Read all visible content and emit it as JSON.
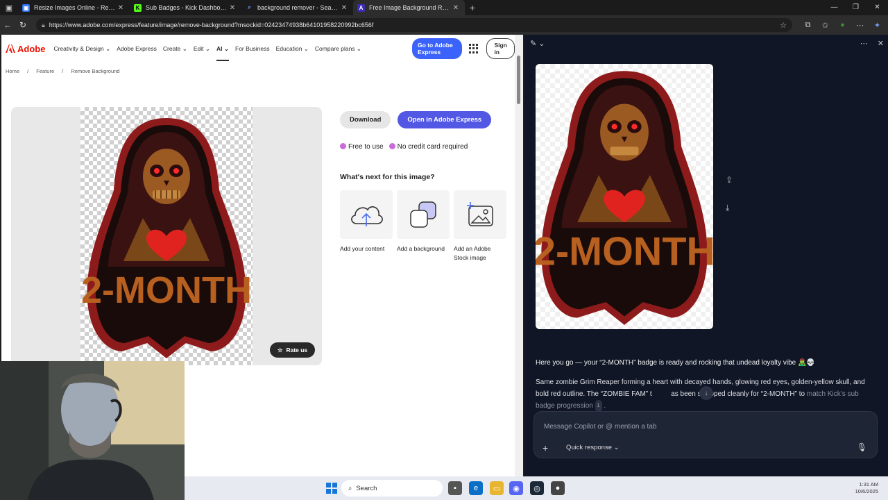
{
  "browser": {
    "tabs": [
      {
        "title": "Resize Images Online - Resize JPG",
        "icon_color": "#2a6ff0",
        "icon": "image-icon"
      },
      {
        "title": "Sub Badges - Kick Dashboard",
        "icon_color": "#53fc18",
        "icon": "kick-icon",
        "icon_glyph": "K"
      },
      {
        "title": "background remover - Search",
        "icon_color": "#2b6ddb",
        "icon": "search-icon"
      },
      {
        "title": "Free Image Background Remover",
        "icon_color": "#3b2bb5",
        "icon": "adobe-express-icon"
      }
    ],
    "url": "https://www.adobe.com/express/feature/image/remove-background?msockid=02423474938b64101958220992bc656f"
  },
  "adobe": {
    "logo": "Adobe",
    "nav": [
      "Creativity & Design",
      "Adobe Express",
      "Create",
      "Edit",
      "AI",
      "For Business",
      "Education",
      "Compare plans"
    ],
    "nav_has_chevron": [
      true,
      false,
      true,
      true,
      true,
      false,
      true,
      true
    ],
    "cta": "Go to Adobe Express",
    "sign_in": "Sign in",
    "breadcrumbs": [
      "Home",
      "/",
      "Feature",
      "/",
      "Remove Background"
    ],
    "rate_us": "Rate us",
    "download": "Download",
    "open_express": "Open in Adobe Express",
    "perks": [
      "Free to use",
      "No credit card required"
    ],
    "next_heading": "What's next for this image?",
    "next_cards": [
      "Add your content",
      "Add a background",
      "Add an Adobe Stock image"
    ]
  },
  "badge": {
    "text": "2-MONTH",
    "colors": {
      "outline": "#8e1b1b",
      "hood": "#3a1212",
      "skull": "#9a5a22",
      "eyes": "#ff2a2a",
      "heart": "#e0231f",
      "text": "#b8601f",
      "base": "#1a0b0b"
    }
  },
  "copilot": {
    "msg1": "Here you go — your “2-MONTH” badge is ready and rocking that undead loyalty vibe 🧟‍♂️💀",
    "msg2a": "Same zombie Grim Reaper forming a heart with decayed hands, glowing red eyes, golden-yellow skull, and bold red outline. The “ZOMBIE FAM” t",
    "msg2b": "as been swapped cleanly for “2-MONTH” to",
    "msg2c": "match Kick’s sub badge progression",
    "cite": "1",
    "msg2d": ".",
    "placeholder": "Message Copilot or @ mention a tab",
    "quick": "Quick response"
  },
  "taskbar": {
    "search": "Search",
    "time": "1:31 AM",
    "date": "10/6/2025"
  }
}
